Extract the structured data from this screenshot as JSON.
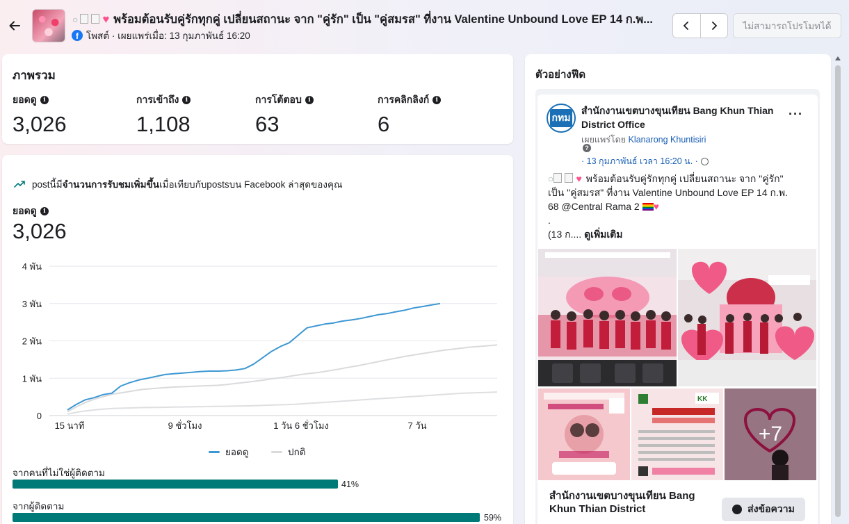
{
  "header": {
    "title": "พร้อมต้อนรับคู่รักทุกคู่ เปลี่ยนสถานะ จาก \"คู่รัก\" เป็น \"คู่สมรส\" ที่งาน Valentine Unbound Love EP 14 ก.พ...",
    "meta": "โพสต์ · เผยแพร่เมื่อ: 13 กุมภาพันธ์ 16:20",
    "promote_label": "ไม่สามารถโปรโมทได้"
  },
  "overview": {
    "title": "ภาพรวม",
    "metrics": [
      {
        "label": "ยอดดู",
        "value": "3,026"
      },
      {
        "label": "การเข้าถึง",
        "value": "1,108"
      },
      {
        "label": "การโต้ตอบ",
        "value": "63"
      },
      {
        "label": "การคลิกลิงก์",
        "value": "6"
      }
    ]
  },
  "detail": {
    "trend_prefix": "postนี้มี",
    "trend_bold": "จำนวนการรับชมเพิ่มขึ้น",
    "trend_suffix": "เมื่อเทียบกับpostsบน Facebook ล่าสุดของคุณ",
    "views_label": "ยอดดู",
    "views_value": "3,026",
    "legend": {
      "views": "ยอดดู",
      "typical": "ปกติ"
    },
    "sources": [
      {
        "label": "จากคนที่ไม่ใช่ผู้ติดตาม",
        "percent": "41%",
        "fraction": 0.41
      },
      {
        "label": "จากผู้ติดตาม",
        "percent": "59%",
        "fraction": 0.59
      }
    ]
  },
  "chart_data": {
    "type": "line",
    "x_tick_labels": [
      "15 นาที",
      "9 ชั่วโมง",
      "1 วัน 6 ชั่วโมง",
      "7 วัน"
    ],
    "y_tick_labels": [
      "0",
      "1 พัน",
      "2 พัน",
      "3 พัน",
      "4 พัน"
    ],
    "ylim": [
      0,
      4000
    ],
    "grid": true,
    "legend_position": "bottom",
    "series": [
      {
        "name": "ยอดดู",
        "color": "#3d97d3",
        "values": [
          150,
          300,
          420,
          480,
          560,
          600,
          790,
          880,
          950,
          1000,
          1050,
          1100,
          1120,
          1140,
          1160,
          1180,
          1190,
          1190,
          1200,
          1220,
          1260,
          1380,
          1550,
          1720,
          1850,
          1950,
          2150,
          2350,
          2400,
          2450,
          2480,
          2530,
          2560,
          2600,
          2650,
          2700,
          2730,
          2780,
          2820,
          2880,
          2920,
          2960,
          3000
        ]
      },
      {
        "name": "ปกติ",
        "color": "#d9dadc",
        "values": [
          100,
          240,
          360,
          450,
          520,
          580,
          620,
          660,
          700,
          720,
          740,
          760,
          770,
          780,
          790,
          800,
          810,
          830,
          860,
          890,
          920,
          950,
          990,
          1020,
          1060,
          1100,
          1130,
          1160,
          1200,
          1240,
          1290,
          1330,
          1380,
          1430,
          1480,
          1530,
          1580,
          1620,
          1660,
          1700,
          1740,
          1770,
          1800,
          1830,
          1850,
          1870,
          1890
        ]
      },
      {
        "values": [
          40,
          100,
          140,
          170,
          190,
          200,
          210,
          215,
          220,
          225,
          230,
          235,
          240,
          245,
          250,
          255,
          260,
          270,
          280,
          290,
          300,
          320,
          340,
          360,
          380,
          400,
          420,
          440,
          460,
          480,
          500,
          520,
          540,
          560,
          580,
          600,
          610,
          620,
          630
        ]
      }
    ]
  },
  "preview": {
    "title": "ตัวอย่างฟีด",
    "page_name": "สำนักงานเขตบางขุนเทียน Bang Khun Thian District Office",
    "avatar_text": "กทม",
    "published_by_prefix": "เผยแพร่โดย",
    "published_by_name": "Klanarong Khuntisiri",
    "date": "· 13 กุมภาพันธ์ เวลา 16:20 น. ·",
    "caption_lines": [
      "พร้อมต้อนรับคู่รักทุกคู่ เปลี่ยนสถานะ จาก \"คู่รัก\"",
      "เป็น \"คู่สมรส\" ที่งาน Valentine Unbound Love EP 14 ก.พ.",
      "68 @Central Rama 2",
      ".",
      "(13 ก...."
    ],
    "see_more": "ดูเพิ่มเติม",
    "photo_overlay": "+7",
    "footer_page_name": "สำนักงานเขตบางขุนเทียน Bang Khun Thian District",
    "message_button": "ส่งข้อความ"
  },
  "colors": {
    "views_line": "#3d97d3",
    "typical_line": "#d9dadc",
    "bar": "#007a78",
    "link": "#1a5fb4"
  }
}
